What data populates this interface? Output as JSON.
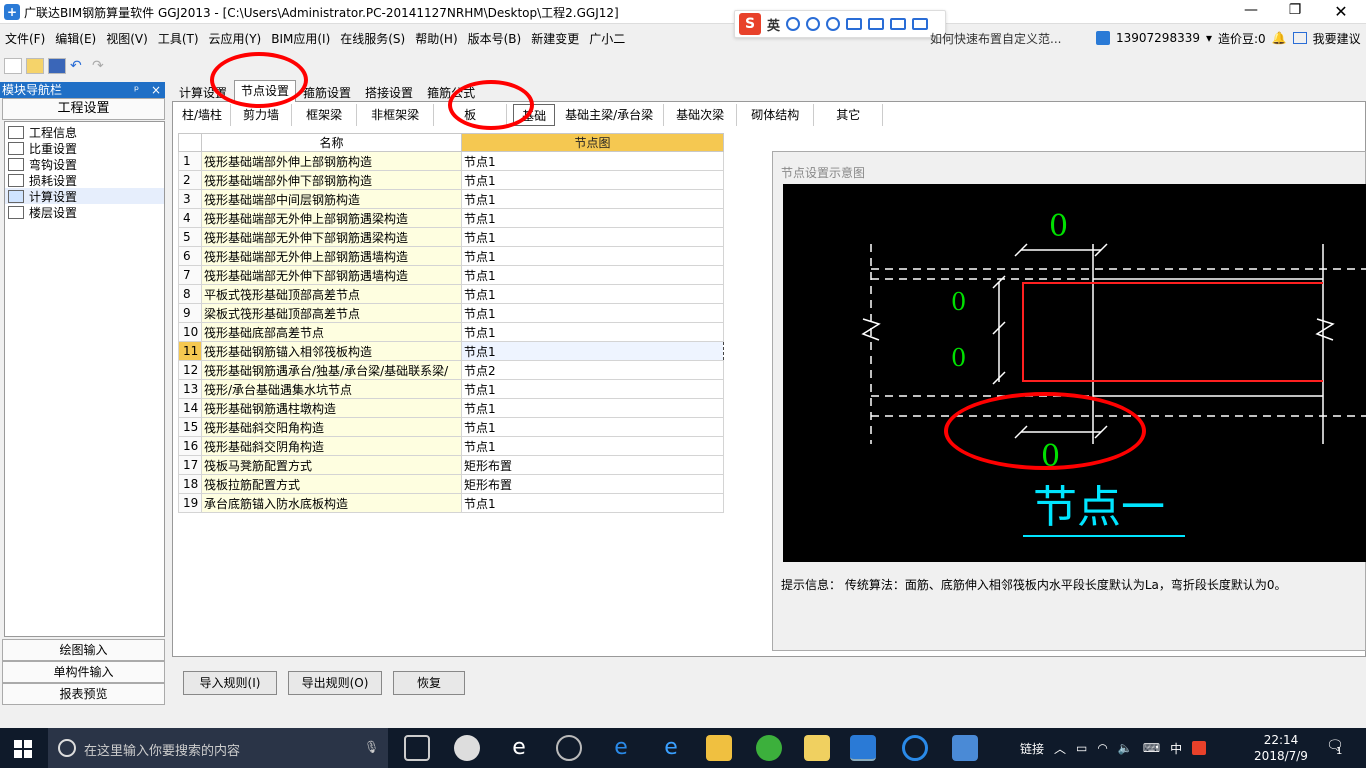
{
  "titlebar": {
    "title": "广联达BIM钢筋算量软件 GGJ2013 - [C:\\Users\\Administrator.PC-20141127NRHM\\Desktop\\工程2.GGJ12]",
    "ime_label": "英"
  },
  "menubar": {
    "items": [
      "文件(F)",
      "编辑(E)",
      "视图(V)",
      "工具(T)",
      "云应用(Y)",
      "BIM应用(I)",
      "在线服务(S)",
      "帮助(H)",
      "版本号(B)",
      "新建变更",
      "广小二"
    ],
    "hint": "如何快速布置自定义范...",
    "phone": "13907298339",
    "price_beans": "造价豆:0",
    "suggest": "我要建议"
  },
  "left_panel": {
    "header": "模块导航栏",
    "pin": "ᵖ",
    "close": "×",
    "section_title": "工程设置",
    "tree": [
      {
        "label": "工程信息"
      },
      {
        "label": "比重设置"
      },
      {
        "label": "弯钩设置"
      },
      {
        "label": "损耗设置"
      },
      {
        "label": "计算设置"
      },
      {
        "label": "楼层设置"
      }
    ],
    "bottom_buttons": [
      "绘图输入",
      "单构件输入",
      "报表预览"
    ]
  },
  "main_tabs": [
    "计算设置",
    "节点设置",
    "箍筋设置",
    "搭接设置",
    "箍筋公式"
  ],
  "sub_tabs": [
    "柱/墙柱",
    "剪力墙",
    "框架梁",
    "非框架梁",
    "板",
    "基础",
    "基础主梁/承台梁",
    "基础次梁",
    "砌体结构",
    "其它"
  ],
  "grid": {
    "headers": [
      "名称",
      "节点图"
    ],
    "rows": [
      {
        "idx": "1",
        "name": "筏形基础端部外伸上部钢筋构造",
        "value": "节点1"
      },
      {
        "idx": "2",
        "name": "筏形基础端部外伸下部钢筋构造",
        "value": "节点1"
      },
      {
        "idx": "3",
        "name": "筏形基础端部中间层钢筋构造",
        "value": "节点1"
      },
      {
        "idx": "4",
        "name": "筏形基础端部无外伸上部钢筋遇梁构造",
        "value": "节点1"
      },
      {
        "idx": "5",
        "name": "筏形基础端部无外伸下部钢筋遇梁构造",
        "value": "节点1"
      },
      {
        "idx": "6",
        "name": "筏形基础端部无外伸上部钢筋遇墙构造",
        "value": "节点1"
      },
      {
        "idx": "7",
        "name": "筏形基础端部无外伸下部钢筋遇墙构造",
        "value": "节点1"
      },
      {
        "idx": "8",
        "name": "平板式筏形基础顶部高差节点",
        "value": "节点1"
      },
      {
        "idx": "9",
        "name": "梁板式筏形基础顶部高差节点",
        "value": "节点1"
      },
      {
        "idx": "10",
        "name": "筏形基础底部高差节点",
        "value": "节点1"
      },
      {
        "idx": "11",
        "name": "筏形基础钢筋锚入相邻筏板构造",
        "value": "节点1"
      },
      {
        "idx": "12",
        "name": "筏形基础钢筋遇承台/独基/承台梁/基础联系梁/",
        "value": "节点2"
      },
      {
        "idx": "13",
        "name": "筏形/承台基础遇集水坑节点",
        "value": "节点1"
      },
      {
        "idx": "14",
        "name": "筏形基础钢筋遇柱墩构造",
        "value": "节点1"
      },
      {
        "idx": "15",
        "name": "筏形基础斜交阳角构造",
        "value": "节点1"
      },
      {
        "idx": "16",
        "name": "筏形基础斜交阴角构造",
        "value": "节点1"
      },
      {
        "idx": "17",
        "name": "筏板马凳筋配置方式",
        "value": "矩形布置"
      },
      {
        "idx": "18",
        "name": "筏板拉筋配置方式",
        "value": "矩形布置"
      },
      {
        "idx": "19",
        "name": "承台底筋锚入防水底板构造",
        "value": "节点1"
      }
    ]
  },
  "preview": {
    "title": "节点设置示意图",
    "node_title": "节点一",
    "label_top": "0",
    "label_mid1": "0",
    "label_mid2": "0",
    "label_bottom": "0",
    "info": "提示信息： 传统算法：面筋、底筋伸入相邻筏板内水平段长度默认为La，弯折段长度默认为0。"
  },
  "bottom_buttons": [
    "导入规则(I)",
    "导出规则(O)",
    "恢复"
  ],
  "taskbar": {
    "search_placeholder": "在这里输入你要搜索的内容",
    "link_label": "链接",
    "ime": "中",
    "time": "22:14",
    "date": "2018/7/9",
    "notif_count": "1"
  },
  "colors": {
    "accent_blue": "#1f6fc6",
    "header_orange": "#f5c851",
    "name_cell": "#fefee0",
    "annotation_red": "#ff0000",
    "diagram_green": "#00e000",
    "diagram_red": "#ff2020",
    "diagram_cyan": "#00e5ff"
  }
}
